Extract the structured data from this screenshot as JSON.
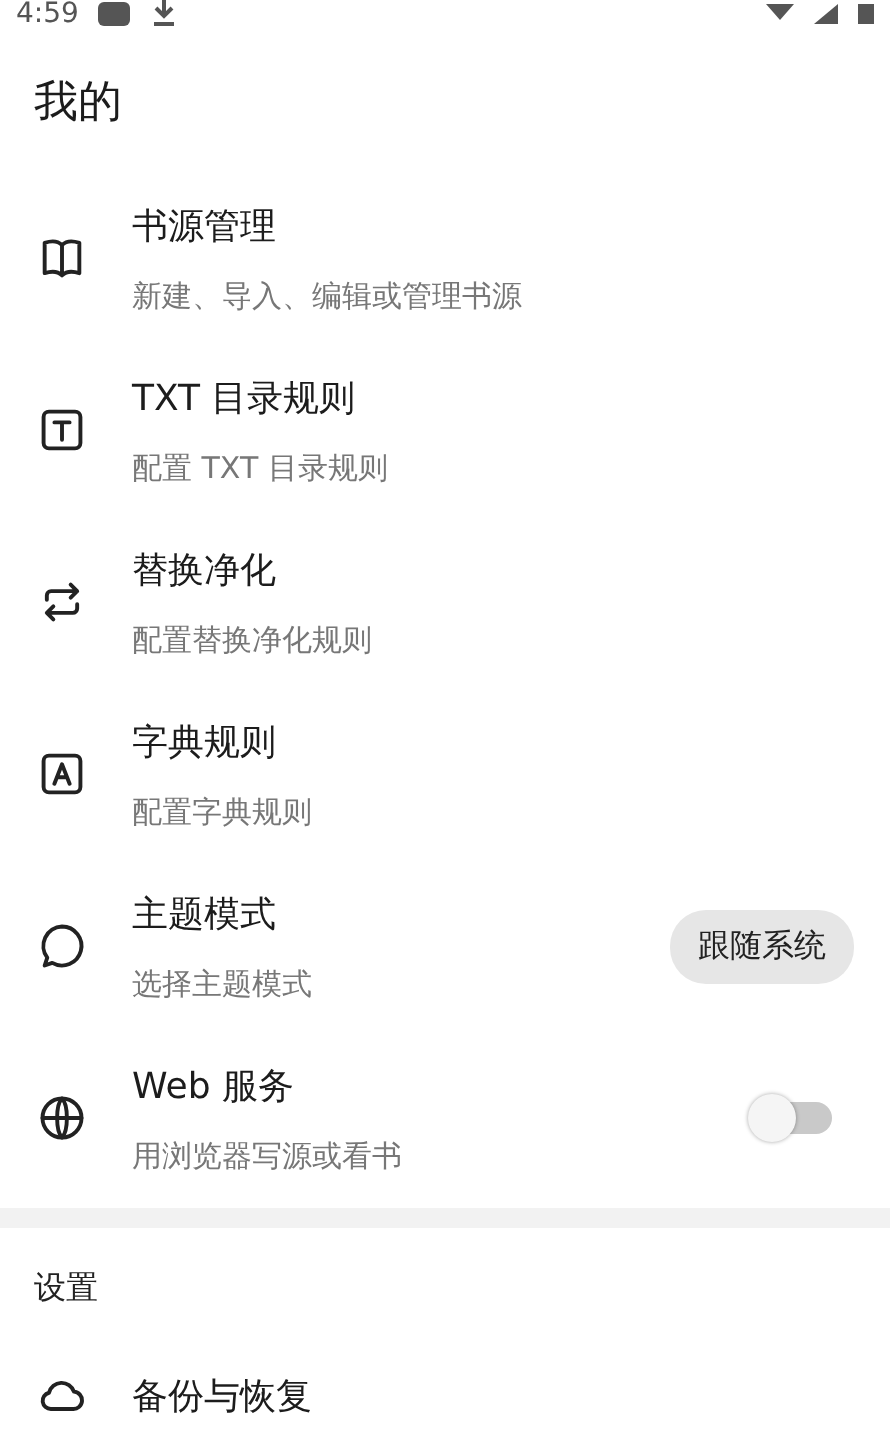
{
  "status_bar": {
    "time": "4:59"
  },
  "title": "我的",
  "items": [
    {
      "title": "书源管理",
      "subtitle": "新建、导入、编辑或管理书源",
      "kind": "plain"
    },
    {
      "title": "TXT 目录规则",
      "subtitle": "配置 TXT 目录规则",
      "kind": "plain"
    },
    {
      "title": "替换净化",
      "subtitle": "配置替换净化规则",
      "kind": "plain"
    },
    {
      "title": "字典规则",
      "subtitle": "配置字典规则",
      "kind": "plain"
    },
    {
      "title": "主题模式",
      "subtitle": "选择主题模式",
      "kind": "chip",
      "value": "跟随系统"
    },
    {
      "title": "Web 服务",
      "subtitle": "用浏览器写源或看书",
      "kind": "switch",
      "on": false
    }
  ],
  "section": {
    "title": "设置",
    "items": [
      {
        "title": "备份与恢复"
      }
    ]
  }
}
